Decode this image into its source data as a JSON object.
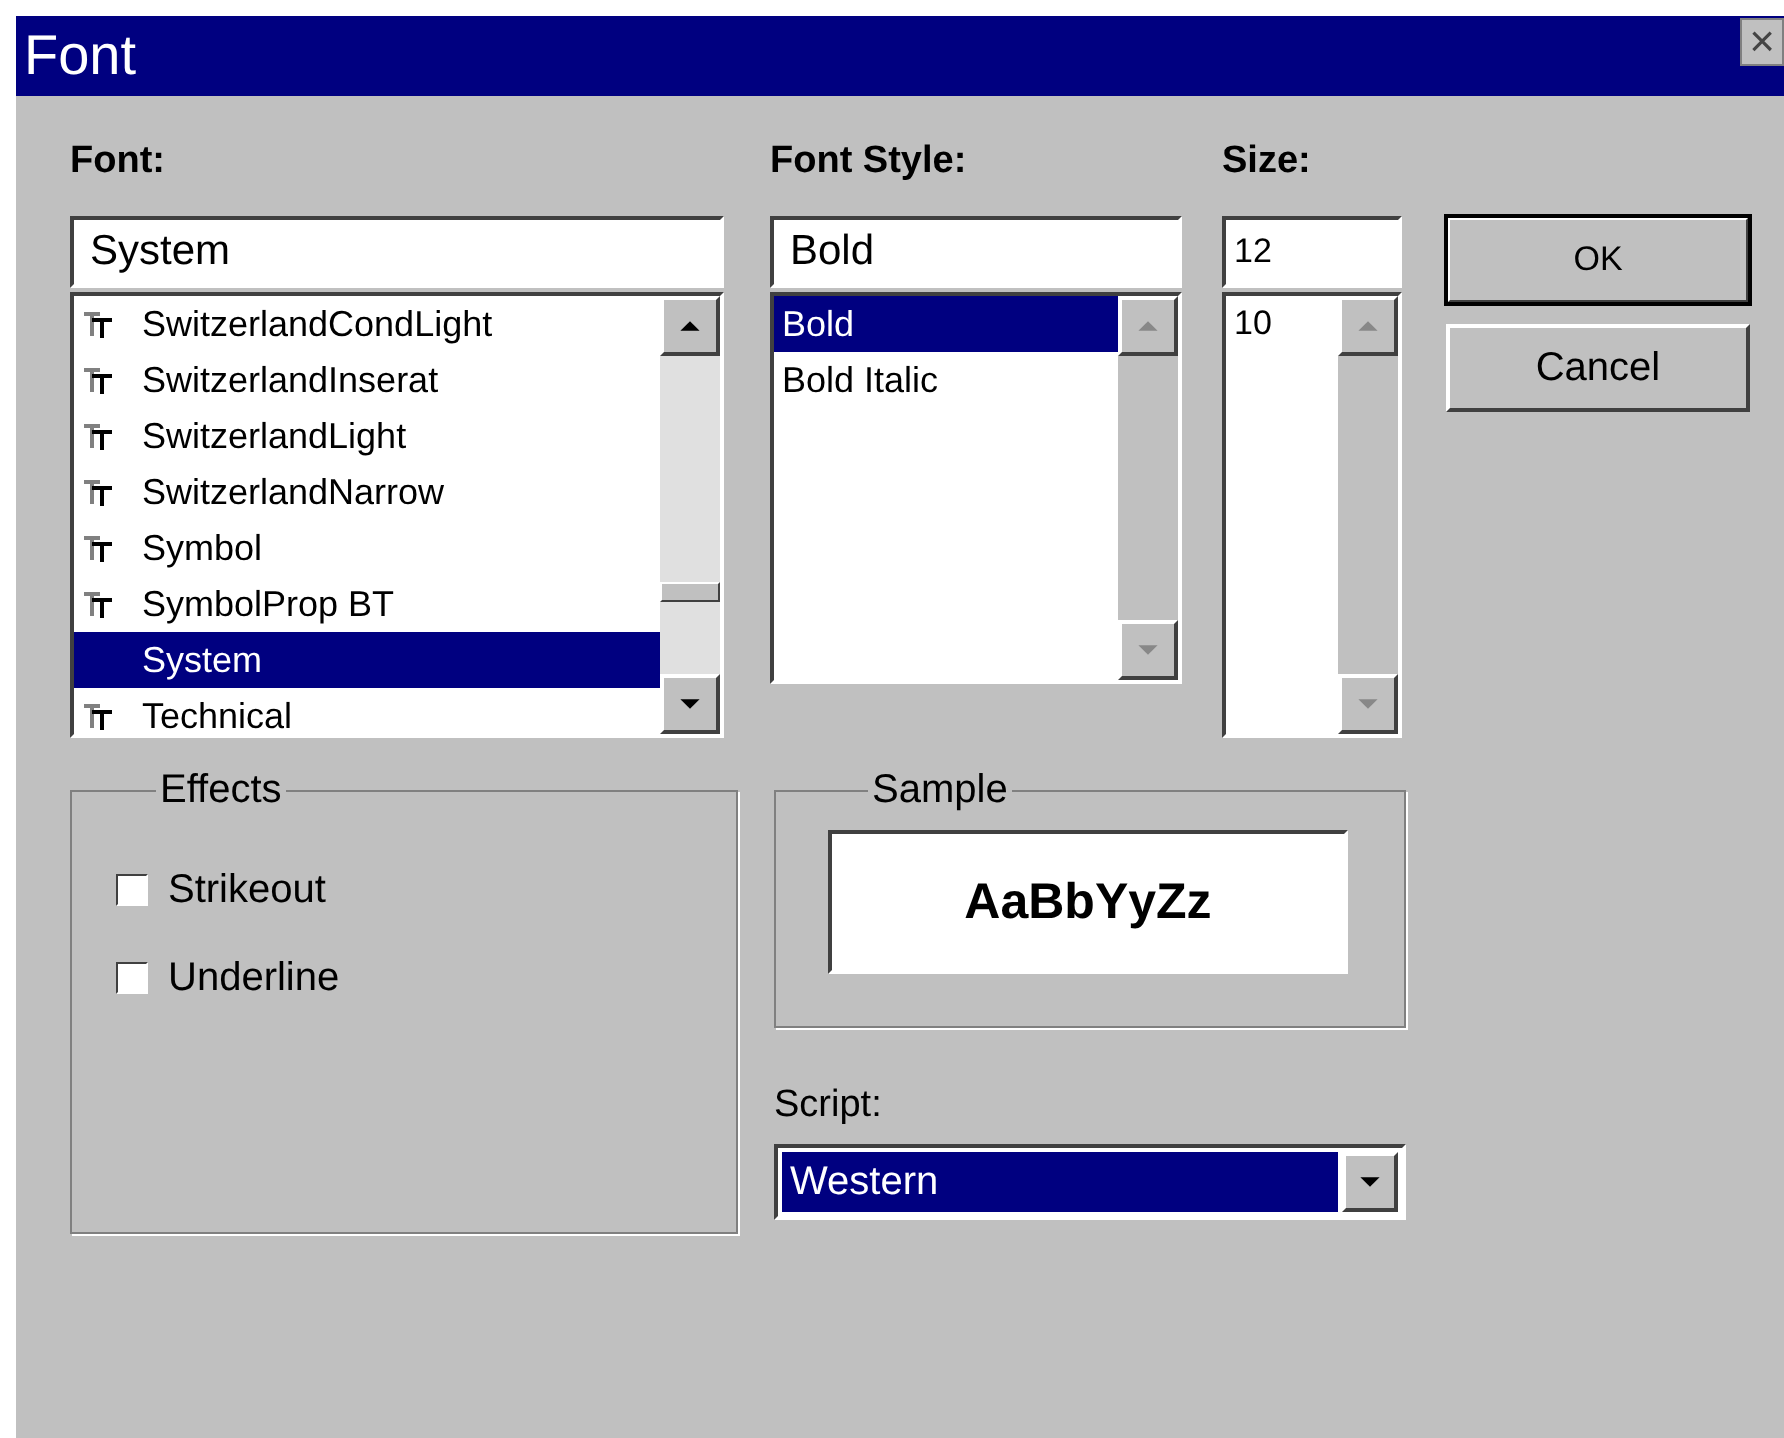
{
  "window": {
    "title": "Font",
    "close": "×"
  },
  "font": {
    "label": "Font:",
    "value": "System",
    "items": [
      {
        "name": "SwitzerlandCondLight",
        "kind": "truetype",
        "selected": false
      },
      {
        "name": "SwitzerlandInserat",
        "kind": "truetype",
        "selected": false
      },
      {
        "name": "SwitzerlandLight",
        "kind": "truetype",
        "selected": false
      },
      {
        "name": "SwitzerlandNarrow",
        "kind": "truetype",
        "selected": false
      },
      {
        "name": "Symbol",
        "kind": "truetype",
        "selected": false
      },
      {
        "name": "SymbolProp BT",
        "kind": "truetype",
        "selected": false
      },
      {
        "name": "System",
        "kind": "raster",
        "selected": true
      },
      {
        "name": "Technical",
        "kind": "truetype",
        "selected": false
      }
    ]
  },
  "font_style": {
    "label": "Font Style:",
    "value": "Bold",
    "items": [
      {
        "name": "Bold",
        "selected": true
      },
      {
        "name": "Bold Italic",
        "selected": false
      }
    ]
  },
  "size": {
    "label": "Size:",
    "value": "12",
    "items": [
      {
        "name": "10",
        "selected": false
      }
    ]
  },
  "buttons": [
    {
      "label": "OK",
      "default": true
    },
    {
      "label": "Cancel",
      "default": false
    }
  ],
  "effects": {
    "title": "Effects",
    "options": [
      {
        "label": "Strikeout",
        "checked": false
      },
      {
        "label": "Underline",
        "checked": false
      }
    ]
  },
  "sample": {
    "title": "Sample",
    "text": "AaBbYyZz"
  },
  "script": {
    "label": "Script:",
    "value": "Western"
  }
}
